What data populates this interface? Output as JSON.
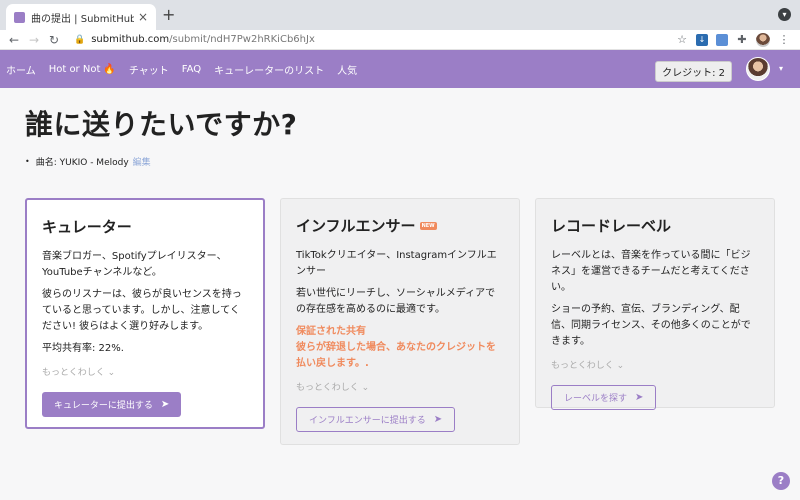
{
  "browser": {
    "tab_title": "曲の提出 | SubmitHub",
    "tab_close": "×",
    "new_tab": "+",
    "url_host": "submithub.com",
    "url_path": "/submit/ndH7Pw2hRKiCb6hJx"
  },
  "nav": {
    "items": [
      "ホーム",
      "Hot or Not",
      "チャット",
      "FAQ",
      "キューレーターのリスト",
      "人気"
    ],
    "credits": "クレジット: 2"
  },
  "page": {
    "title": "誰に送りたいですか?",
    "song_label": "曲名: YUKIO - Melody",
    "song_edit": "編集"
  },
  "cards": [
    {
      "title": "キュレーター",
      "paragraphs": [
        "音楽ブロガー、Spotifyプレイリスター、YouTubeチャンネルなど。",
        "彼らのリスナーは、彼らが良いセンスを持っていると思っています。しかし、注意してください! 彼らはよく選り好みします。",
        "平均共有率: 22%."
      ],
      "more": "もっとくわしく ⌄",
      "button": "キュレーターに提出する"
    },
    {
      "title": "インフルエンサー",
      "badge": "NEW",
      "paragraphs": [
        "TikTokクリエイター、Instagramインフルエンサー",
        "若い世代にリーチし、ソーシャルメディアでの存在感を高めるのに最適です。"
      ],
      "warning": "保証された共有\n彼らが辞退した場合、あなたのクレジットを払い戻します。.",
      "more": "もっとくわしく ⌄",
      "button": "インフルエンサーに提出する"
    },
    {
      "title": "レコードレーベル",
      "paragraphs": [
        "レーベルとは、音楽を作っている間に「ビジネス」を運営できるチームだと考えてください。",
        "ショーの予約、宣伝、ブランディング、配信、同期ライセンス、その他多くのことができます。"
      ],
      "more": "もっとくわしく ⌄",
      "button": "レーベルを探す"
    }
  ],
  "help": "?",
  "colors": {
    "brand": "#9b7ec6",
    "warning": "#f08a5d"
  }
}
